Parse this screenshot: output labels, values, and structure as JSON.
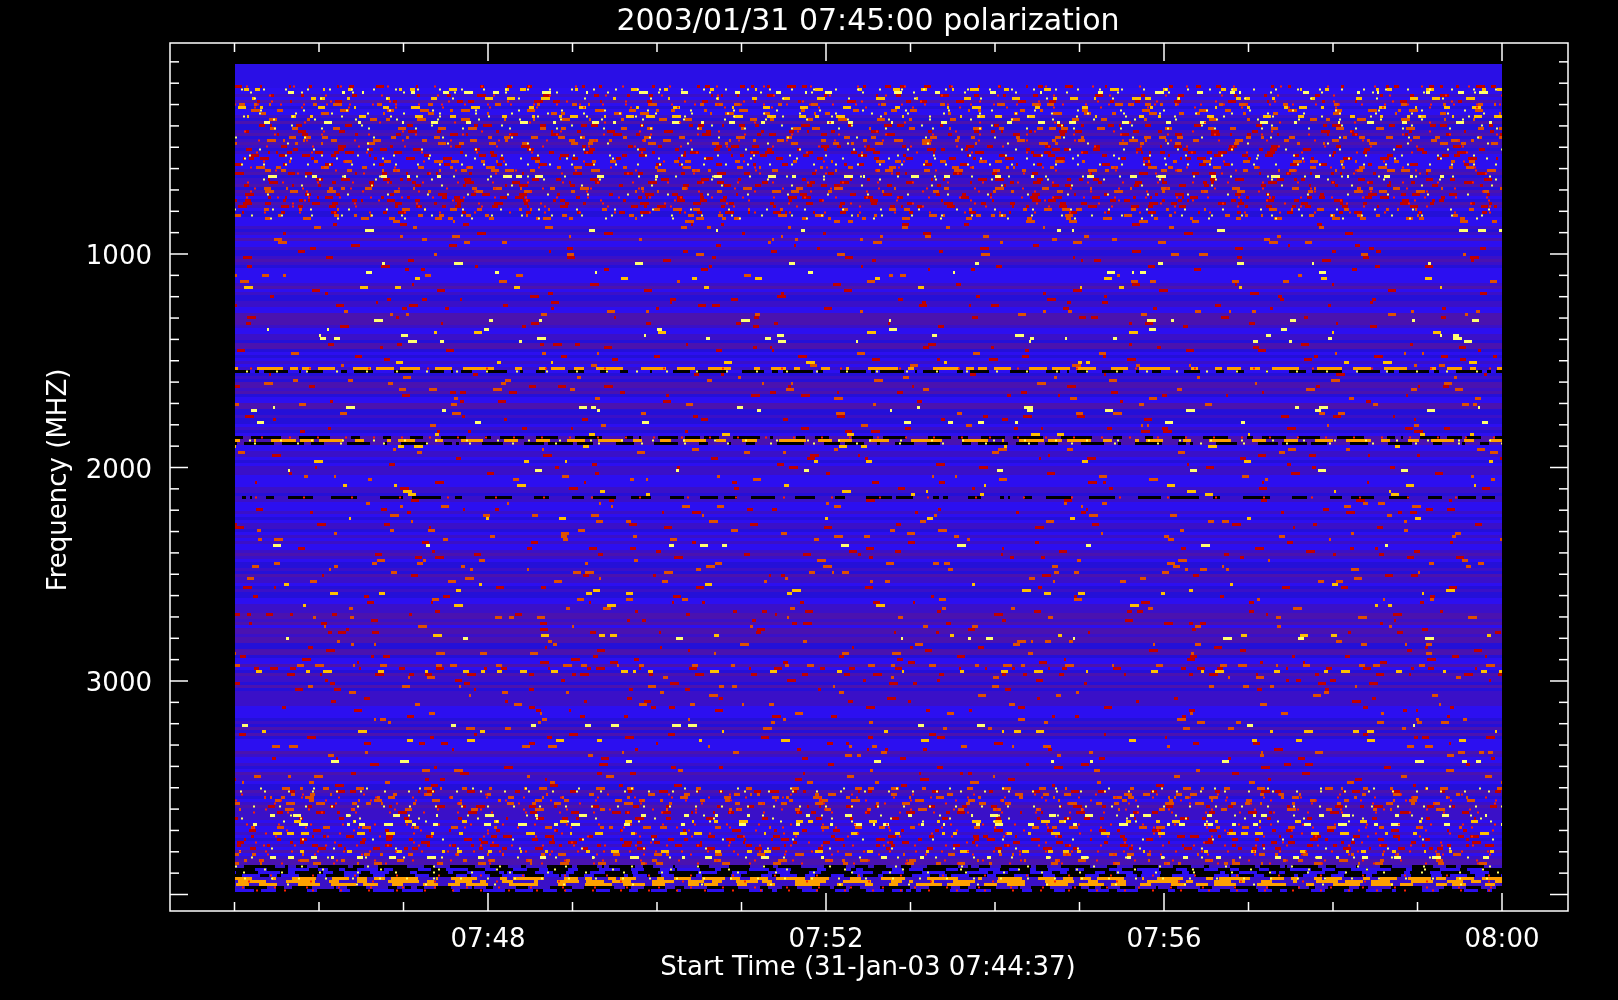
{
  "title": "2003/01/31 07:45:00 polarization",
  "y_axis": {
    "label": "Frequency (MHZ)",
    "ticks": [
      "1000",
      "2000",
      "3000"
    ]
  },
  "x_axis": {
    "label": "Start Time (31-Jan-03 07:44:37)",
    "ticks": [
      "07:48",
      "07:52",
      "07:56",
      "08:00"
    ]
  }
}
